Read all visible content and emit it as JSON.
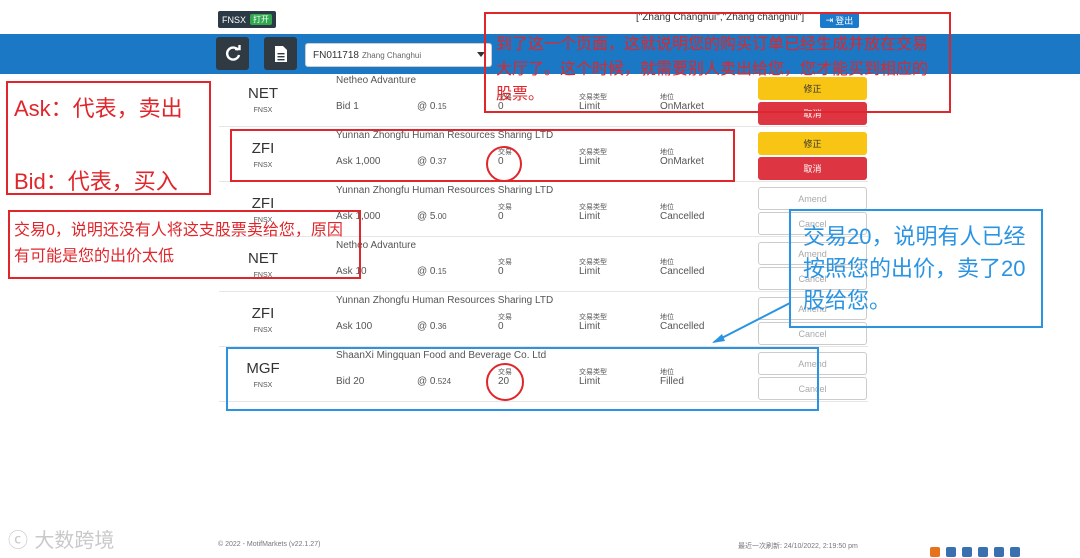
{
  "topbar": {
    "exchange": "FNSX",
    "open_label": "打开",
    "user_names": "[\"Zhang Changhui\",\"Zhang changhui\"]",
    "logout_label": "登出"
  },
  "toolbar": {
    "refresh_icon": "refresh-icon",
    "document_icon": "document-icon",
    "account": {
      "code": "FN011718",
      "name": "Zhang Changhui"
    }
  },
  "labels": {
    "trade": "交易",
    "trade_type": "交易类型",
    "status": "地位"
  },
  "orders": [
    {
      "symbol": "NET",
      "exchange": "FNSX",
      "company": "Netheo Advanture",
      "side": "Bid 1",
      "price": "@ 0.15",
      "trades": "0",
      "type": "Limit",
      "status": "OnMarket",
      "amend": "修正",
      "cancel": "取消",
      "style": "active"
    },
    {
      "symbol": "ZFI",
      "exchange": "FNSX",
      "company": "Yunnan Zhongfu Human Resources Sharing LTD",
      "side": "Ask 1,000",
      "price": "@ 0.37",
      "trades": "0",
      "type": "Limit",
      "status": "OnMarket",
      "amend": "修正",
      "cancel": "取消",
      "style": "active"
    },
    {
      "symbol": "ZFI",
      "exchange": "FNSX",
      "company": "Yunnan Zhongfu Human Resources Sharing LTD",
      "side": "Ask 1,000",
      "price": "@ 5.00",
      "trades": "0",
      "type": "Limit",
      "status": "Cancelled",
      "amend": "Amend",
      "cancel": "Cancel",
      "style": "ghost"
    },
    {
      "symbol": "NET",
      "exchange": "FNSX",
      "company": "Netheo Advanture",
      "side": "Ask 10",
      "price": "@ 0.15",
      "trades": "0",
      "type": "Limit",
      "status": "Cancelled",
      "amend": "Amend",
      "cancel": "Cancel",
      "style": "ghost"
    },
    {
      "symbol": "ZFI",
      "exchange": "FNSX",
      "company": "Yunnan Zhongfu Human Resources Sharing LTD",
      "side": "Ask 100",
      "price": "@ 0.36",
      "trades": "0",
      "type": "Limit",
      "status": "Cancelled",
      "amend": "Amend",
      "cancel": "Cancel",
      "style": "ghost"
    },
    {
      "symbol": "MGF",
      "exchange": "FNSX",
      "company": "ShaanXi Mingquan Food and Beverage Co. Ltd",
      "side": "Bid 20",
      "price": "@ 0.524",
      "trades": "20",
      "type": "Limit",
      "status": "Filled",
      "amend": "Amend",
      "cancel": "Cancel",
      "style": "ghost"
    }
  ],
  "footer": {
    "copyright": "© 2022 - MotifMarkets (v22.1.27)",
    "last_refresh": "最近一次刷新: 24/10/2022, 2:19:50 pm"
  },
  "watermark": "大数跨境",
  "annotations": {
    "top": "到了这一个页面，这就说明您的购买订单已经生成并放在交易大厅了。这个时候，就需要别人卖出给您，您才能买到相应的股票。",
    "ask": "Ask：代表，卖出",
    "bid": "Bid：代表，买入",
    "zero": "交易0，说明还没有人将这支股票卖给您，原因有可能是您的出价太低",
    "twenty": "交易20，说明有人已经按照您的出价，卖了20股给您。"
  },
  "colors": {
    "brand_blue": "#1b78c4",
    "amend_yellow": "#f8c514",
    "cancel_red": "#dd3542",
    "annotation_red": "#e0262b",
    "annotation_blue": "#2a94e2"
  }
}
